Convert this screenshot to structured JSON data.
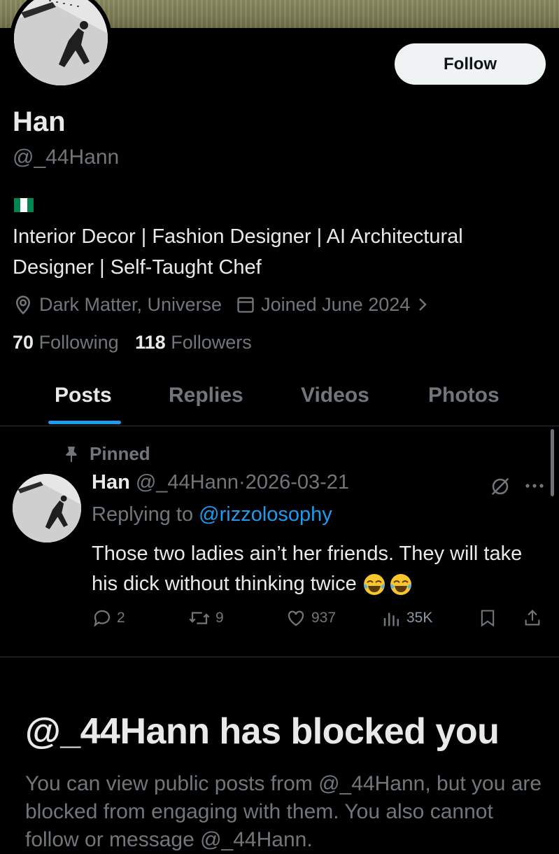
{
  "profile": {
    "name": "Han",
    "handle": "@_44Hann",
    "bio": "Interior Decor | Fashion Designer | AI Architectural Designer | Self-Taught Chef",
    "location": "Dark Matter, Universe",
    "joined": "Joined June 2024",
    "following_count": "70",
    "following_label": "Following",
    "followers_count": "118",
    "followers_label": "Followers",
    "flag_colors": [
      "#008751",
      "#ffffff",
      "#008751"
    ]
  },
  "follow_button": {
    "label": "Follow"
  },
  "tabs": [
    {
      "label": "Posts",
      "active": true
    },
    {
      "label": "Replies"
    },
    {
      "label": "Videos"
    },
    {
      "label": "Photos"
    }
  ],
  "post": {
    "pinned_label": "Pinned",
    "author": "Han",
    "handle": "@_44Hann",
    "separator": "·",
    "date": "2026-03-21",
    "replying_prefix": "Replying to",
    "replying_to": "@rizzolosophy",
    "text": "Those two ladies ain’t her friends. They will take his dick without thinking twice",
    "emojis": [
      "face-with-tears-of-joy",
      "face-with-tears-of-joy"
    ],
    "replies": "2",
    "reposts": "9",
    "likes": "937",
    "views": "35K"
  },
  "blocked": {
    "title": "@_44Hann has blocked you",
    "text": "You can view public posts from @_44Hann, but you are blocked from engaging with them. You also cannot follow or message @_44Hann."
  },
  "colors": {
    "background": "#000000",
    "accent": "#1d9bf0",
    "muted": "#71767b",
    "primary_text": "#e7e9ea"
  }
}
